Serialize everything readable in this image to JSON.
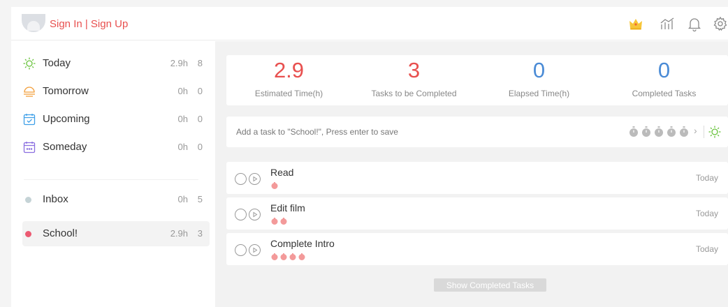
{
  "header": {
    "signin_label": "Sign In | Sign Up",
    "icons": [
      "crown-icon",
      "stats-icon",
      "bell-icon",
      "settings-icon"
    ]
  },
  "sidebar": {
    "items": [
      {
        "label": "Today",
        "hours": "2.9h",
        "count": "8",
        "icon": "sun-icon"
      },
      {
        "label": "Tomorrow",
        "hours": "0h",
        "count": "0",
        "icon": "sunset-icon"
      },
      {
        "label": "Upcoming",
        "hours": "0h",
        "count": "0",
        "icon": "calendar-check-icon"
      },
      {
        "label": "Someday",
        "hours": "0h",
        "count": "0",
        "icon": "calendar-dots-icon"
      }
    ],
    "projects": [
      {
        "label": "Inbox",
        "hours": "0h",
        "count": "5",
        "color": "#c5d3d6"
      },
      {
        "label": "School!",
        "hours": "2.9h",
        "count": "3",
        "color": "#ec5a72",
        "active": true
      }
    ]
  },
  "stats": [
    {
      "value": "2.9",
      "label": "Estimated Time(h)"
    },
    {
      "value": "3",
      "label": "Tasks to be Completed"
    },
    {
      "value": "0",
      "label": "Elapsed Time(h)"
    },
    {
      "value": "0",
      "label": "Completed Tasks"
    }
  ],
  "add_task": {
    "placeholder": "Add a task to \"School!\", Press enter to save",
    "chevron": "›"
  },
  "tasks": [
    {
      "name": "Read",
      "pomodoros": 1,
      "date": "Today"
    },
    {
      "name": "Edit film",
      "pomodoros": 2,
      "date": "Today"
    },
    {
      "name": "Complete Intro",
      "pomodoros": 4,
      "date": "Today"
    }
  ],
  "show_completed_label": "Show Completed Tasks",
  "colors": {
    "accent": "#e8504f",
    "stat_zero": "#4a8bd6",
    "today_green": "#67c23a",
    "tomorrow_orange": "#f29d38",
    "upcoming_blue": "#3fa0e8",
    "someday_purple": "#8a6ee0",
    "pomodoro_pink": "#f39a9a"
  }
}
